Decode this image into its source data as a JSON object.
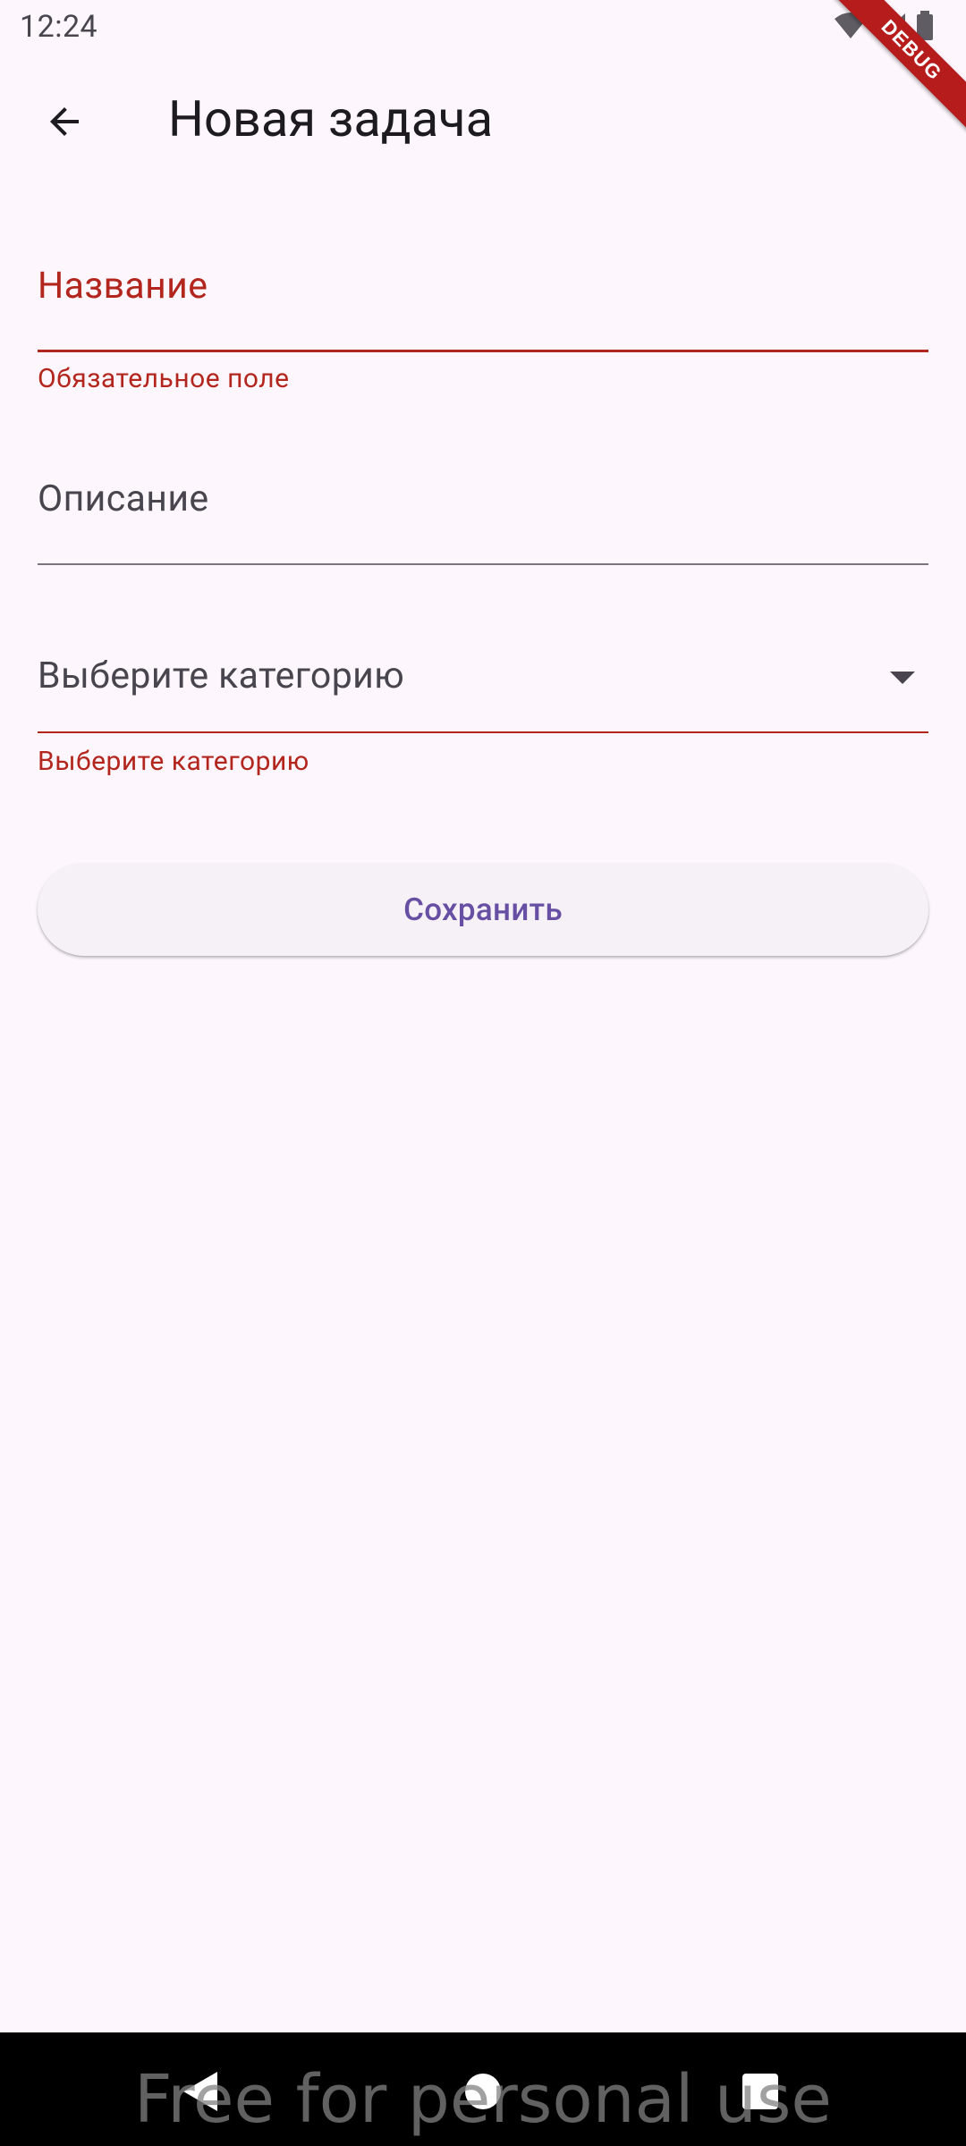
{
  "status_bar": {
    "time": "12:24",
    "icons": [
      "wifi-icon",
      "signal-icon",
      "battery-icon"
    ]
  },
  "debug_banner": {
    "label": "DEBUG"
  },
  "app_bar": {
    "back_icon": "arrow-back-icon",
    "title": "Новая задача"
  },
  "form": {
    "title_field": {
      "label": "Название",
      "value": "",
      "error": "Обязательное поле"
    },
    "description_field": {
      "label": "Описание",
      "value": ""
    },
    "category_field": {
      "placeholder": "Выберите категорию",
      "error": "Выберите категорию",
      "icon": "dropdown-arrow-icon"
    },
    "save_label": "Сохранить"
  },
  "nav_bar": {
    "icons": [
      "nav-back-icon",
      "nav-home-icon",
      "nav-recents-icon"
    ]
  },
  "watermark": "Free for personal use",
  "colors": {
    "background": "#fdf7fd",
    "error": "#b3261e",
    "primary": "#6750a4",
    "on_surface": "#1d1b20",
    "on_surface_variant": "#49454f"
  }
}
